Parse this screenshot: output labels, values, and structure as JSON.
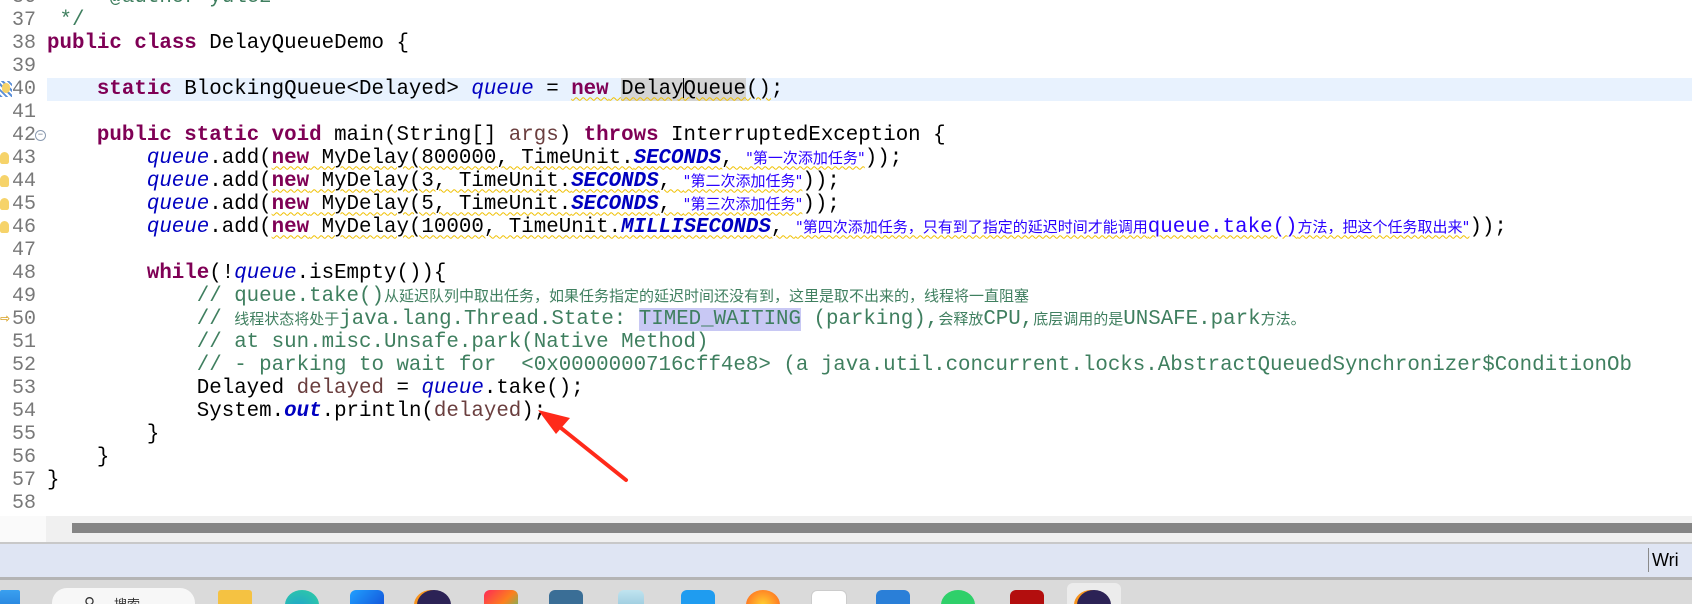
{
  "editor": {
    "colors": {
      "keyword": "#7f0055",
      "field": "#0000c0",
      "string": "#2a00ff",
      "comment": "#3f7f5f",
      "local": "#6a3e3e",
      "current_line": "#e8f2fe"
    },
    "current_line": 40,
    "lines": [
      {
        "n": "36",
        "tokens": [
          [
            "     ",
            ""
          ],
          [
            "@author yulez",
            "cmt"
          ]
        ]
      },
      {
        "n": "37",
        "tokens": [
          [
            " */",
            "cmt"
          ]
        ]
      },
      {
        "n": "38",
        "tokens": [
          [
            "public",
            "kw"
          ],
          [
            " ",
            ""
          ],
          [
            "class",
            "kw"
          ],
          [
            " DelayQueueDemo {",
            ""
          ]
        ]
      },
      {
        "n": "39",
        "tokens": []
      },
      {
        "n": "40",
        "marker": "warning",
        "tokens": [
          [
            "    ",
            ""
          ],
          [
            "static",
            "kw"
          ],
          [
            " BlockingQueue<Delayed> ",
            ""
          ],
          [
            "queue",
            "fld"
          ],
          [
            " = ",
            ""
          ],
          [
            "new",
            "kw sq"
          ],
          [
            " ",
            "sq"
          ],
          [
            "Delay",
            "sq occ"
          ],
          [
            "|caret",
            ""
          ],
          [
            "Queue",
            "sq occ"
          ],
          [
            "()",
            "sq"
          ],
          [
            ";",
            ""
          ]
        ]
      },
      {
        "n": "41",
        "tokens": []
      },
      {
        "n": "42",
        "fold": true,
        "tokens": [
          [
            "    ",
            ""
          ],
          [
            "public",
            "kw"
          ],
          [
            " ",
            ""
          ],
          [
            "static",
            "kw"
          ],
          [
            " ",
            ""
          ],
          [
            "void",
            "kw"
          ],
          [
            " main(String[] ",
            ""
          ],
          [
            "args",
            "loc"
          ],
          [
            ") ",
            ""
          ],
          [
            "throws",
            "kw"
          ],
          [
            " InterruptedException {",
            ""
          ]
        ]
      },
      {
        "n": "43",
        "marker": "warning",
        "tokens": [
          [
            "        ",
            ""
          ],
          [
            "queue",
            "fld"
          ],
          [
            ".add(",
            ""
          ],
          [
            "new",
            "kw sq"
          ],
          [
            " MyDelay(800000, TimeUnit.",
            "sq"
          ],
          [
            "SECONDS",
            "sfld sq"
          ],
          [
            ", ",
            "sq"
          ],
          [
            "\"第一次添加任务\"",
            "str cjk sq"
          ],
          [
            ")",
            ""
          ],
          [
            ");",
            ""
          ]
        ]
      },
      {
        "n": "44",
        "marker": "warning",
        "tokens": [
          [
            "        ",
            ""
          ],
          [
            "queue",
            "fld"
          ],
          [
            ".add(",
            ""
          ],
          [
            "new",
            "kw sq"
          ],
          [
            " MyDelay(3, TimeUnit.",
            "sq"
          ],
          [
            "SECONDS",
            "sfld sq"
          ],
          [
            ", ",
            "sq"
          ],
          [
            "\"第二次添加任务\"",
            "str cjk sq"
          ],
          [
            ")",
            ""
          ],
          [
            ");",
            ""
          ]
        ]
      },
      {
        "n": "45",
        "marker": "warning",
        "tokens": [
          [
            "        ",
            ""
          ],
          [
            "queue",
            "fld"
          ],
          [
            ".add(",
            ""
          ],
          [
            "new",
            "kw sq"
          ],
          [
            " MyDelay(5, TimeUnit.",
            "sq"
          ],
          [
            "SECONDS",
            "sfld sq"
          ],
          [
            ", ",
            "sq"
          ],
          [
            "\"第三次添加任务\"",
            "str cjk sq"
          ],
          [
            ")",
            ""
          ],
          [
            ");",
            ""
          ]
        ]
      },
      {
        "n": "46",
        "marker": "warning",
        "tokens": [
          [
            "        ",
            ""
          ],
          [
            "queue",
            "fld"
          ],
          [
            ".add(",
            ""
          ],
          [
            "new",
            "kw sq"
          ],
          [
            " MyDelay(10000, TimeUnit.",
            "sq"
          ],
          [
            "MILLISECONDS",
            "sfld sq"
          ],
          [
            ", ",
            "sq"
          ],
          [
            "\"第四次添加任务，只有到了指定的延迟时间才能调用",
            "str cjk sq"
          ],
          [
            "queue.take()",
            "str sq"
          ],
          [
            "方法，把这个任务取出来\"",
            "str cjk sq"
          ],
          [
            ")",
            ""
          ],
          [
            ");",
            ""
          ]
        ]
      },
      {
        "n": "47",
        "tokens": []
      },
      {
        "n": "48",
        "tokens": [
          [
            "        ",
            ""
          ],
          [
            "while",
            "kw"
          ],
          [
            "(!",
            ""
          ],
          [
            "queue",
            "fld"
          ],
          [
            ".isEmpty()){",
            ""
          ]
        ]
      },
      {
        "n": "49",
        "tokens": [
          [
            "            ",
            ""
          ],
          [
            "// queue.take()",
            "cmt"
          ],
          [
            "从延迟队列中取出任务，如果任务指定的延迟时间还没有到，这里是取不出来的，线程将一直阻塞",
            "cmt cjk"
          ]
        ]
      },
      {
        "n": "50",
        "marker": "arrow",
        "tokens": [
          [
            "            ",
            ""
          ],
          [
            "// ",
            "cmt"
          ],
          [
            "线程状态将处于",
            "cmt cjk"
          ],
          [
            "java.lang.Thread.State: ",
            "cmt"
          ],
          [
            "TIMED_WAITING",
            "cmt occ2"
          ],
          [
            " (parking),",
            "cmt"
          ],
          [
            "会释放",
            "cmt cjk"
          ],
          [
            "CPU,",
            "cmt"
          ],
          [
            "底层调用的是",
            "cmt cjk"
          ],
          [
            "UNSAFE.park",
            "cmt"
          ],
          [
            "方法。",
            "cmt cjk"
          ]
        ]
      },
      {
        "n": "51",
        "tokens": [
          [
            "            ",
            ""
          ],
          [
            "// at sun.misc.Unsafe.park(Native Method)",
            "cmt"
          ]
        ]
      },
      {
        "n": "52",
        "tokens": [
          [
            "            ",
            ""
          ],
          [
            "// - parking to wait for  <0x0000000716cff4e8> (a java.util.concurrent.locks.AbstractQueuedSynchronizer$ConditionOb",
            "cmt"
          ]
        ]
      },
      {
        "n": "53",
        "tokens": [
          [
            "            ",
            ""
          ],
          [
            "Delayed ",
            ""
          ],
          [
            "delayed",
            "loc"
          ],
          [
            " = ",
            ""
          ],
          [
            "queue",
            "fld"
          ],
          [
            ".take();",
            ""
          ]
        ]
      },
      {
        "n": "54",
        "tokens": [
          [
            "            ",
            ""
          ],
          [
            "System.",
            ""
          ],
          [
            "out",
            "sfld"
          ],
          [
            ".println(",
            ""
          ],
          [
            "delayed",
            "loc"
          ],
          [
            ");",
            ""
          ]
        ]
      },
      {
        "n": "55",
        "tokens": [
          [
            "        }",
            ""
          ]
        ]
      },
      {
        "n": "56",
        "tokens": [
          [
            "    }",
            ""
          ]
        ]
      },
      {
        "n": "57",
        "tokens": [
          [
            "}",
            ""
          ]
        ]
      },
      {
        "n": "58",
        "tokens": []
      }
    ]
  },
  "annotation": {
    "color": "#ff2a1a",
    "shape": "arrow"
  },
  "status_bar": {
    "mode": "Wri"
  },
  "taskbar": {
    "search_label": "搜索",
    "icons": [
      "windows-start-icon",
      "file-explorer-icon",
      "edge-icon",
      "app-icon",
      "eclipse-icon",
      "intellij-icon",
      "mysql-workbench-icon",
      "app-icon",
      "vscode-icon",
      "firefox-icon",
      "typora-icon",
      "app-icon",
      "wechat-icon",
      "app-icon",
      "eclipse-icon"
    ]
  }
}
